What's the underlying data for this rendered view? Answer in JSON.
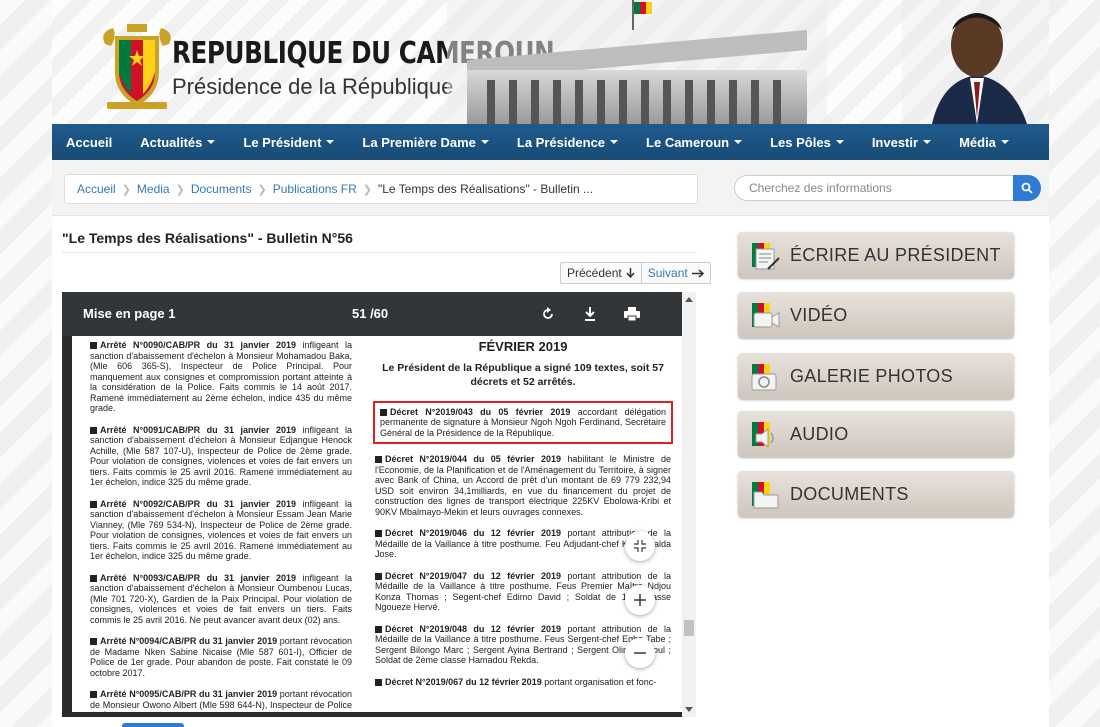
{
  "header": {
    "title": "REPUBLIQUE DU CAMEROUN",
    "subtitle": "Présidence de la République"
  },
  "nav": {
    "items": [
      {
        "label": "Accueil",
        "dropdown": false
      },
      {
        "label": "Actualités",
        "dropdown": true
      },
      {
        "label": "Le Président",
        "dropdown": true
      },
      {
        "label": "La Première Dame",
        "dropdown": true
      },
      {
        "label": "La Présidence",
        "dropdown": true
      },
      {
        "label": "Le Cameroun",
        "dropdown": true
      },
      {
        "label": "Les Pôles",
        "dropdown": true
      },
      {
        "label": "Investir",
        "dropdown": true
      },
      {
        "label": "Média",
        "dropdown": true
      }
    ]
  },
  "breadcrumb": {
    "items": [
      "Accueil",
      "Media",
      "Documents",
      "Publications FR"
    ],
    "current": "\"Le Temps des Réalisations\" - Bulletin ..."
  },
  "search": {
    "placeholder": "Cherchez des informations"
  },
  "page": {
    "title": "\"Le Temps des Réalisations\" - Bulletin N°56",
    "prev_label": "Précédent",
    "next_label": "Suivant"
  },
  "pdf": {
    "doc_title": "Mise en page 1",
    "page_indicator": "51 /60",
    "left_column": [
      {
        "bold": "Arrêté N°0090/CAB/PR du 31 janvier 2019",
        "text": " infligeant la sanction d'abaissement d'échelon à Monsieur Mohamadou Baka, (Mle 606 365-S), Inspecteur de Police Principal. Pour manquement aux consignes et compromission portant atteinte à la considération de la Police. Faits commis le 14 août 2017. Ramené immédiatement au 2ème échelon, indice 435 du même grade."
      },
      {
        "bold": "Arrêté N°0091/CAB/PR du 31 janvier 2019",
        "text": " infligeant la sanction d'abaissement d'échelon à Monsieur Edjangue Henock Achille, (Mle 587 107-U), Inspecteur de Police de 2ème grade. Pour violation de consignes, violences et voies de fait envers un tiers. Faits commis le 25 avril 2016. Ramené immédiatement au 1er échelon, indice 325 du même grade."
      },
      {
        "bold": "Arrêté N°0092/CAB/PR du 31 janvier 2019",
        "text": " infligeant la sanction d'abaissement d'échelon à Monsieur Essam Jean Marie Vianney, (Mle 769 534-N), Inspecteur de Police de 2ème grade. Pour violation de consignes, violences et voies de fait envers un tiers. Faits commis le 25 avril 2016. Ramené immédiatement au 1er échelon, indice 325 du même grade."
      },
      {
        "bold": "Arrêté N°0093/CAB/PR du 31 janvier 2019",
        "text": " infligeant la sanction d'abaissement d'échelon à Monsieur Oumbenou Lucas, (Mle 701 720-X), Gardien de la Paix Principal. Pour violation de consignes, violences et voies de fait envers un tiers. Faits commis le 25 avril 2016. Ne peut avancer avant deux (02) ans."
      },
      {
        "bold": "Arrêté N°0094/CAB/PR du 31 janvier 2019",
        "text": " portant révocation de Madame Nken Sabine Nicaise (Mle 587 601-I), Officier de Police de 1er grade. Pour abandon de poste. Fait constaté le 09 octobre 2017."
      },
      {
        "bold": "Arrêté N°0095/CAB/PR du 31 janvier 2019",
        "text": " portant révocation de Monsieur Owono Albert (Mle 598 644-N), Inspecteur de Police de 1er"
      }
    ],
    "month_heading": "FÉVRIER 2019",
    "summary": "Le Président de la République a signé 109 textes, soit 57 décrets et 52 arrêtés.",
    "highlighted": {
      "bold": "Décret N°2019/043 du 05 février 2019",
      "text": " accordant délégation permanente de signature à Monsieur Ngoh Ngoh Ferdinand, Secrétaire Général de la Présidence de la République."
    },
    "right_column": [
      {
        "bold": "Décret N°2019/044 du 05 février 2019",
        "text": " habilitant le Ministre de l'Economie, de la Planification et de l'Aménagement du Territoire, à signer avec Bank of China, un Accord de prêt d'un montant de 69 779 232,94 USD soit environ 34,1milliards, en vue du financement du projet de construction des lignes de transport électrique 225KV Ebolowa-Kribi et 90KV Mbalmayo-Mekin et leurs ouvrages connexes."
      },
      {
        "bold": "Décret N°2019/046 du 12 février 2019",
        "text": " portant attribution de la Médaille de la Vaillance à titre posthume. Feu Adjudant-chef Kalda Kalda Jose."
      },
      {
        "bold": "Décret N°2019/047 du 12 février 2019",
        "text": " portant attribution de la Médaille de la Vaillance à titre posthume. Feus Premier Maître Ndjou Konza Thomas ; Segent-chef Edimo David ; Soldat de 1ère classe Ngoueze Hervé."
      },
      {
        "bold": "Décret N°2019/048 du 12 février 2019",
        "text": " portant attribution de la Médaille de la Vaillance à titre posthume. Feus Sergent-chef Egbe Tabe ; Sergent Bilongo Marc ; Sergent Ayina Bertrand ; Sergent Olinga Raoul ; Soldat de 2ème classe Hamadou Rekda."
      },
      {
        "bold": "Décret N°2019/067 du 12 février 2019",
        "text": " portant organisation et fonc-"
      }
    ]
  },
  "sidebar": {
    "items": [
      {
        "label": "ÉCRIRE AU PRÉSIDENT",
        "icon": "pen-icon"
      },
      {
        "label": "VIDÉO",
        "icon": "video-camera-icon"
      },
      {
        "label": "GALERIE PHOTOS",
        "icon": "photo-camera-icon"
      },
      {
        "label": "AUDIO",
        "icon": "speaker-icon"
      },
      {
        "label": "DOCUMENTS",
        "icon": "folder-icon"
      }
    ]
  },
  "colors": {
    "nav": "#1f5a8c",
    "accent": "#2e7bd6",
    "flag_green": "#007a3d",
    "flag_red": "#ce1126",
    "flag_yellow": "#fcd116",
    "highlight": "#e02020"
  }
}
